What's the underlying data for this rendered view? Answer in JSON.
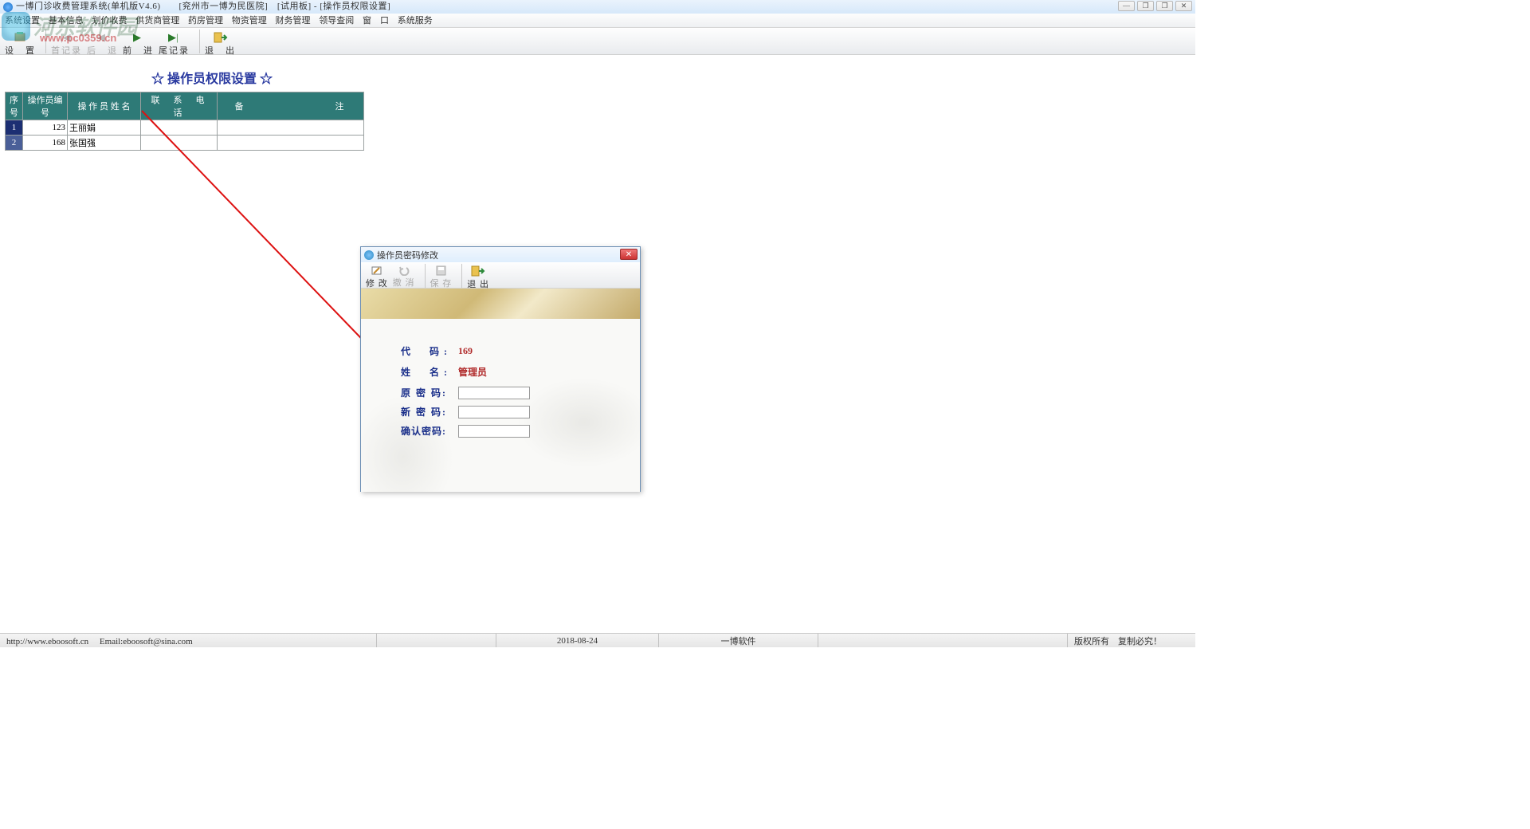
{
  "window": {
    "title": "一博门诊收费管理系统(单机版V4.6)　　[兖州市一博为民医院]　[试用板] - [操作员权限设置]",
    "controls": {
      "min": "—",
      "restore": "❐",
      "close": "✕",
      "mdi_restore": "❐"
    }
  },
  "menubar": [
    "系统设置",
    "基本信息",
    "划价收费",
    "供货商管理",
    "药房管理",
    "物资管理",
    "财务管理",
    "领导查阅",
    "窗　口",
    "系统服务"
  ],
  "toolbar": {
    "settings": "设　置",
    "first": "首记录",
    "back": "后　退",
    "forward": "前　进",
    "last": "尾记录",
    "exit": "退　出"
  },
  "watermark": {
    "text": "河东软件园",
    "url": "www.pc0359.cn"
  },
  "page": {
    "title": "☆ 操作员权限设置 ☆"
  },
  "table": {
    "headers": {
      "seq": "序号",
      "opcode": "操作员编号",
      "opname": "操 作 员 姓 名",
      "phone": "联　系　电　话",
      "remark": "备　　　　　　　　注"
    },
    "rows": [
      {
        "seq": "1",
        "code": "123",
        "name": "王丽娟",
        "phone": "",
        "remark": ""
      },
      {
        "seq": "2",
        "code": "168",
        "name": "张国强",
        "phone": "",
        "remark": ""
      }
    ]
  },
  "dialog": {
    "title": "操作员密码修改",
    "toolbar": {
      "edit": "修 改",
      "undo": "撤 消",
      "save": "保 存",
      "exit": "退 出"
    },
    "fields": {
      "code_lbl": "代　码:",
      "code_val": "169",
      "name_lbl": "姓　名:",
      "name_val": "管理员",
      "old_lbl": "原 密 码:",
      "new_lbl": "新 密 码:",
      "confirm_lbl": "确认密码:"
    },
    "close": "✕"
  },
  "status": {
    "url": "http://www.eboosoft.cn　 Email:eboosoft@sina.com",
    "date": "2018-08-24",
    "company": "一博软件",
    "copyright": "版权所有　复制必究！"
  }
}
